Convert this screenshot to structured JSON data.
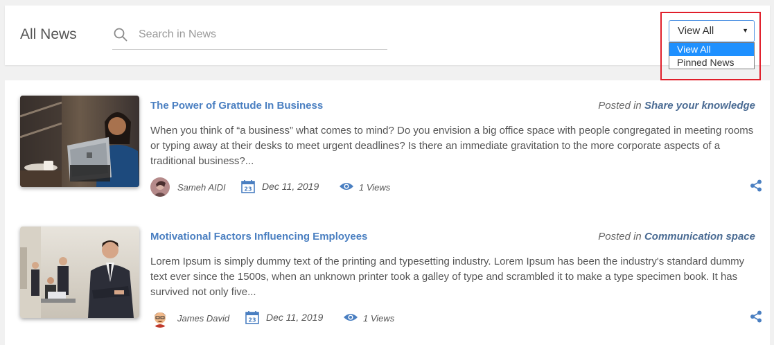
{
  "header": {
    "title": "All News",
    "search": {
      "placeholder": "Search in News",
      "value": ""
    },
    "filter": {
      "selected": "View All",
      "options": [
        "View All",
        "Pinned News"
      ]
    }
  },
  "news": [
    {
      "title": "The Power of Grattude In Business",
      "posted_prefix": "Posted in",
      "category": "Share your knowledge",
      "excerpt": "When you think of “a business” what comes to mind?  Do you envision a big office space with people congregated in meeting rooms or typing away at their desks to meet urgent deadlines? Is there an immediate gravitation to the more corporate aspects of a traditional business?...",
      "author": "Sameh AIDI",
      "date": "Dec 11, 2019",
      "views": "1 Views",
      "calendar_day": "23"
    },
    {
      "title": "Motivational Factors Influencing Employees",
      "posted_prefix": "Posted in",
      "category": "Communication space",
      "excerpt": "Lorem Ipsum is simply dummy text of the printing and typesetting industry. Lorem Ipsum has been the industry's standard dummy text ever since the 1500s, when an unknown printer took a galley of type and scrambled it to make a type specimen book. It has survived not only five...",
      "author": "James David",
      "date": "Dec 11, 2019",
      "views": "1 Views",
      "calendar_day": "23"
    }
  ],
  "colors": {
    "accent": "#4a7fc1",
    "highlight_border": "#e01e2a",
    "selected_option": "#1e90ff"
  },
  "icons": [
    "search-icon",
    "calendar-icon",
    "eye-icon",
    "share-icon",
    "chevron-down-icon"
  ]
}
